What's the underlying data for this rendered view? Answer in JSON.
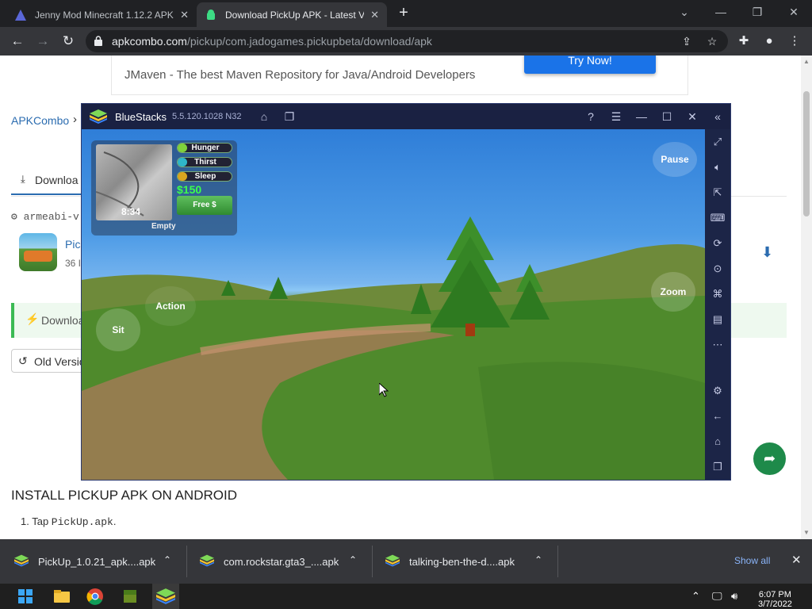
{
  "tabs": [
    {
      "title": "Jenny Mod Minecraft 1.12.2 APK",
      "active": false
    },
    {
      "title": "Download PickUp APK - Latest V",
      "active": true
    }
  ],
  "url": {
    "host": "apkcombo.com",
    "path": "/pickup/com.jadogames.pickupbeta/download/apk"
  },
  "page": {
    "banner_text": "JMaven - The best Maven Repository for Java/Android Developers",
    "try_now": "Try Now!",
    "breadcrumb": "APKCombo",
    "download_tab": "Downloa",
    "arch": "armeabi-v",
    "app_name": "Pic",
    "app_size": "36 I",
    "notice": "Downloa",
    "old_versions": "Old Versio",
    "install_title": "INSTALL PICKUP APK ON ANDROID",
    "step1_prefix": "1. Tap ",
    "step1_file": "PickUp.apk",
    "step1_suffix": "."
  },
  "bluestacks": {
    "name": "BlueStacks",
    "version": "5.5.120.1028",
    "arch": "N32"
  },
  "game": {
    "time": "8:34",
    "bars": [
      {
        "label": "Hunger",
        "color": "#7fd13b"
      },
      {
        "label": "Thirst",
        "color": "#2fb6c9"
      },
      {
        "label": "Sleep",
        "color": "#d9a520"
      }
    ],
    "money": "$150",
    "free_button": "Free $",
    "inventory": "Empty",
    "pause": "Pause",
    "zoom": "Zoom",
    "action": "Action",
    "sit": "Sit"
  },
  "downloads": [
    {
      "file": "PickUp_1.0.21_apk....apk"
    },
    {
      "file": "com.rockstar.gta3_....apk"
    },
    {
      "file": "talking-ben-the-d....apk"
    }
  ],
  "show_all": "Show all",
  "clock": {
    "time": "6:07 PM",
    "date": "3/7/2022"
  }
}
